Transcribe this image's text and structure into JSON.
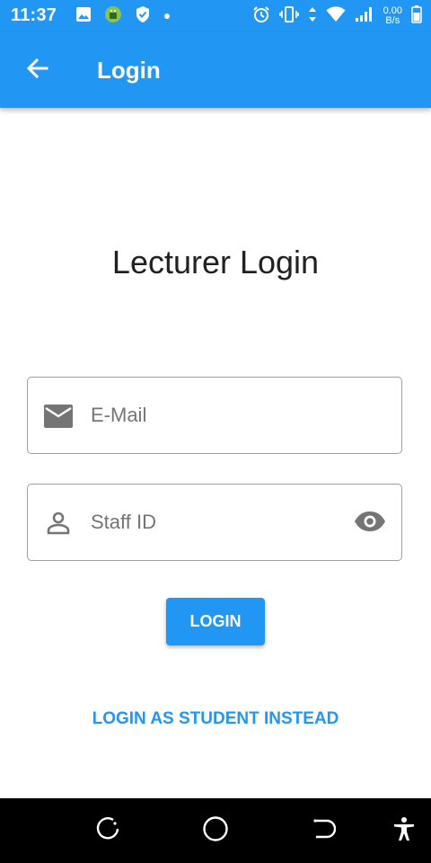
{
  "status_bar": {
    "time": "11:37",
    "net_speed_value": "0.00",
    "net_speed_unit": "B/s",
    "icons": [
      "image-icon",
      "android-icon",
      "shield-icon",
      "dot-icon",
      "alarm-icon",
      "vibrate-icon",
      "data-arrows-icon",
      "wifi-icon",
      "signal-icon",
      "battery-icon"
    ]
  },
  "app_bar": {
    "title": "Login",
    "back_icon": "arrow-back-icon",
    "color": "#2196f3"
  },
  "main": {
    "heading": "Lecturer Login",
    "email_field": {
      "placeholder": "E-Mail",
      "value": "",
      "icon": "mail-icon"
    },
    "staff_field": {
      "placeholder": "Staff ID",
      "value": "",
      "icon": "person-icon",
      "toggle_icon": "visibility-icon"
    },
    "login_button_label": "LOGIN",
    "switch_link_label": "LOGIN AS STUDENT INSTEAD"
  },
  "nav_bar": {
    "buttons": [
      "recents-icon",
      "home-icon",
      "back-icon",
      "accessibility-icon"
    ]
  },
  "colors": {
    "accent": "#2196f3",
    "text": "#212121",
    "border": "#9e9e9e",
    "icon_gray": "#757575"
  }
}
